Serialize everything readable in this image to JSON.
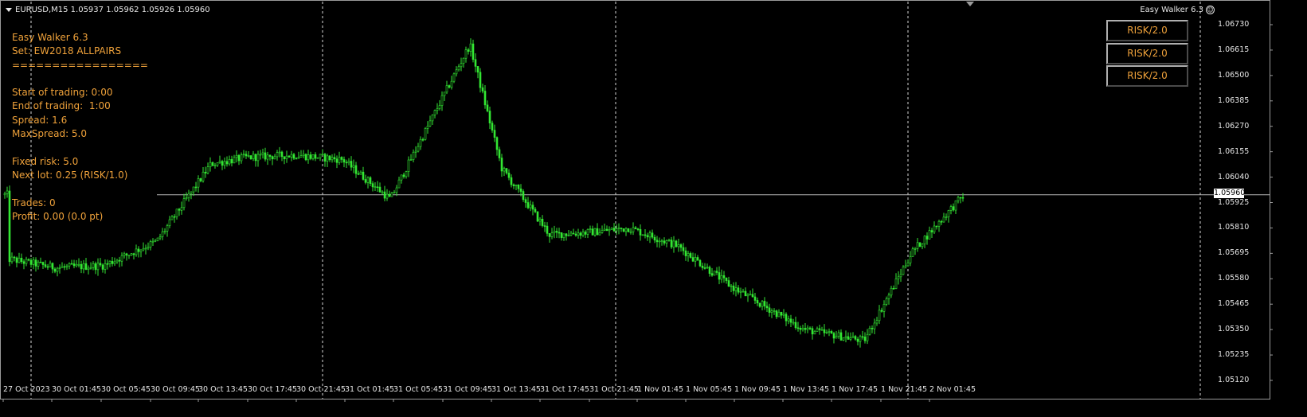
{
  "symbol_line": "EURUSD,M15  1.05937 1.05962 1.05926 1.05960",
  "ea_title": "Easy Walker 6.3",
  "smiley_glyph": "☺",
  "info_panel": [
    "Easy Walker 6.3",
    "Set: EW2018 ALLPAIRS",
    "=================",
    "",
    "Start of trading: 0:00",
    "End of trading:  1:00",
    "Spread: 1.6",
    "MaxSpread: 5.0",
    "",
    "Fixed risk: 5.0",
    "Next lot: 0.25 (RISK/1.0)",
    "",
    "Trades: 0",
    "Profit: 0.00 (0.0 pt)"
  ],
  "buttons": [
    "RISK/2.0",
    "RISK/2.0",
    "RISK/2.0"
  ],
  "price_axis": [
    "1.06730",
    "1.06615",
    "1.06500",
    "1.06385",
    "1.06270",
    "1.06155",
    "1.06040",
    "1.05925",
    "1.05810",
    "1.05695",
    "1.05580",
    "1.05465",
    "1.05350",
    "1.05235",
    "1.05120"
  ],
  "current_price": "1.05960",
  "time_axis": [
    "27 Oct 2023",
    "30 Oct 01:45",
    "30 Oct 05:45",
    "30 Oct 09:45",
    "30 Oct 13:45",
    "30 Oct 17:45",
    "30 Oct 21:45",
    "31 Oct 01:45",
    "31 Oct 05:45",
    "31 Oct 09:45",
    "31 Oct 13:45",
    "31 Oct 17:45",
    "31 Oct 21:45",
    "1 Nov 01:45",
    "1 Nov 05:45",
    "1 Nov 09:45",
    "1 Nov 13:45",
    "1 Nov 17:45",
    "1 Nov 21:45",
    "2 Nov 01:45"
  ],
  "colors": {
    "candle": "#33e633",
    "background": "#000000",
    "text": "#e6e6e6",
    "panel_text": "#f0a23a",
    "grid": "#d8d8d8"
  },
  "chart_data": {
    "type": "candlestick-line",
    "symbol": "EURUSD",
    "timeframe": "M15",
    "ylim": [
      1.0512,
      1.0673
    ],
    "bid": 1.0596,
    "path": [
      {
        "t": "27 Oct 2023",
        "p": 1.0567
      },
      {
        "t": "30 Oct 01:45",
        "p": 1.0563
      },
      {
        "t": "30 Oct 05:45",
        "p": 1.0564
      },
      {
        "t": "30 Oct 09:45",
        "p": 1.0575
      },
      {
        "t": "30 Oct 13:45",
        "p": 1.061
      },
      {
        "t": "30 Oct 17:45",
        "p": 1.0613
      },
      {
        "t": "30 Oct 21:45",
        "p": 1.0614
      },
      {
        "t": "31 Oct 01:45",
        "p": 1.0612
      },
      {
        "t": "31 Oct 05:45",
        "p": 1.0594
      },
      {
        "t": "31 Oct 09:45",
        "p": 1.0664
      },
      {
        "t": "31 Oct 13:45",
        "p": 1.0608
      },
      {
        "t": "31 Oct 17:45",
        "p": 1.0578
      },
      {
        "t": "31 Oct 21:45",
        "p": 1.0579
      },
      {
        "t": "1 Nov 01:45",
        "p": 1.0581
      },
      {
        "t": "1 Nov 05:45",
        "p": 1.0573
      },
      {
        "t": "1 Nov 09:45",
        "p": 1.0554
      },
      {
        "t": "1 Nov 13:45",
        "p": 1.0535
      },
      {
        "t": "1 Nov 17:45",
        "p": 1.053
      },
      {
        "t": "1 Nov 21:45",
        "p": 1.057
      },
      {
        "t": "2 Nov 01:45",
        "p": 1.0596
      }
    ]
  }
}
